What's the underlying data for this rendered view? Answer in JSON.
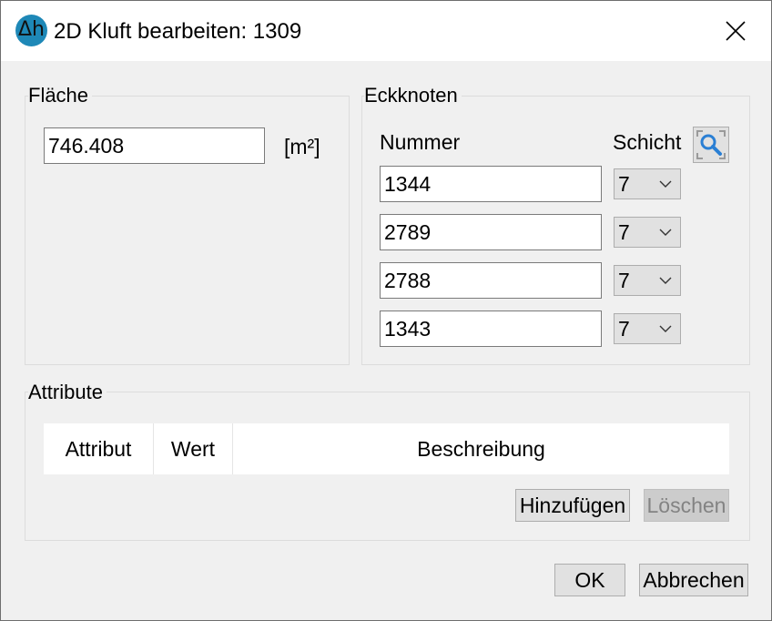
{
  "window": {
    "title": "2D Kluft bearbeiten: 1309",
    "app_icon_glyph": "Δh"
  },
  "flaeche": {
    "legend": "Fläche",
    "value": "746.408",
    "unit": "[m²]"
  },
  "eckknoten": {
    "legend": "Eckknoten",
    "col_nummer": "Nummer",
    "col_schicht": "Schicht",
    "rows": [
      {
        "nummer": "1344",
        "schicht": "7"
      },
      {
        "nummer": "2789",
        "schicht": "7"
      },
      {
        "nummer": "2788",
        "schicht": "7"
      },
      {
        "nummer": "1343",
        "schicht": "7"
      }
    ],
    "search_icon": "zoom-search-icon"
  },
  "attribute": {
    "legend": "Attribute",
    "columns": [
      "Attribut",
      "Wert",
      "Beschreibung"
    ],
    "add_label": "Hinzufügen",
    "delete_label": "Löschen"
  },
  "footer": {
    "ok_label": "OK",
    "cancel_label": "Abbrechen"
  },
  "colors": {
    "accent": "#1e88b7",
    "search_icon": "#2a7fd4"
  }
}
